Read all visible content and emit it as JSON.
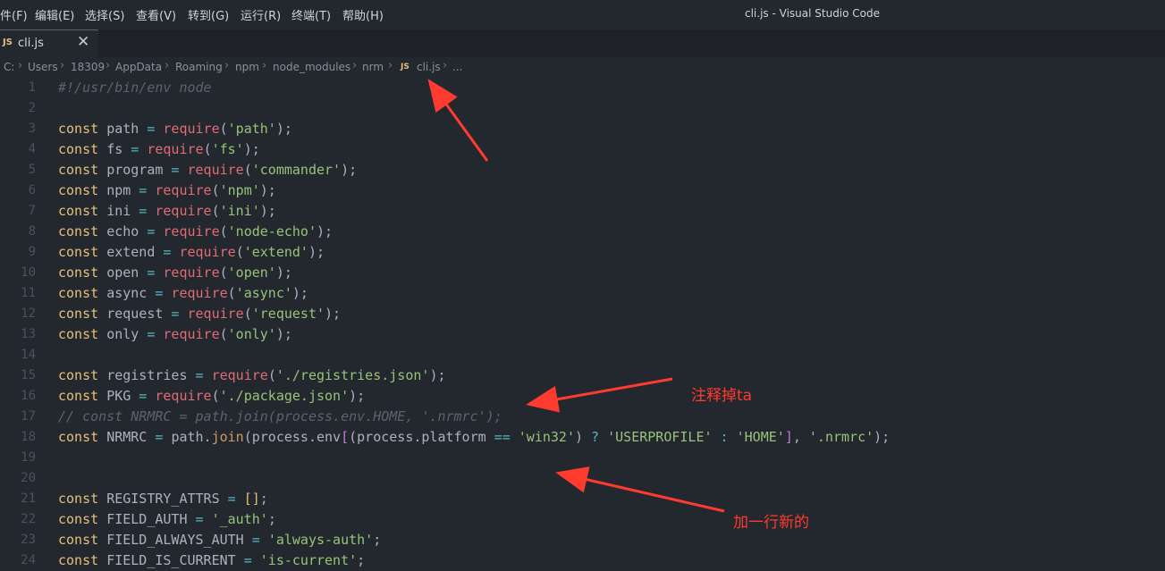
{
  "menu": {
    "items": [
      "件(F)",
      "编辑(E)",
      "选择(S)",
      "查看(V)",
      "转到(G)",
      "运行(R)",
      "终端(T)",
      "帮助(H)"
    ]
  },
  "window_title": "cli.js - Visual Studio Code",
  "tab": {
    "label": "cli.js",
    "badge": "JS",
    "close": "✕"
  },
  "breadcrumb": {
    "items": [
      "C:",
      "Users",
      "18309",
      "AppData",
      "Roaming",
      "npm",
      "node_modules",
      "nrm",
      "cli.js",
      "..."
    ],
    "separator": "›"
  },
  "editor": {
    "lines": [
      {
        "n": "1",
        "tokens": [
          [
            "com",
            "#!/usr/bin/env node"
          ]
        ]
      },
      {
        "n": "2",
        "tokens": []
      },
      {
        "n": "3",
        "tokens": [
          [
            "kw",
            "const"
          ],
          [
            "",
            "path"
          ],
          [
            "op",
            "="
          ],
          [
            "fn",
            "require"
          ],
          [
            "",
            "("
          ],
          [
            "str",
            "'path'"
          ],
          [
            "",
            ");"
          ]
        ]
      },
      {
        "n": "4",
        "tokens": [
          [
            "kw",
            "const"
          ],
          [
            "",
            "fs"
          ],
          [
            "op",
            "="
          ],
          [
            "fn",
            "require"
          ],
          [
            "",
            "("
          ],
          [
            "str",
            "'fs'"
          ],
          [
            "",
            ");"
          ]
        ]
      },
      {
        "n": "5",
        "tokens": [
          [
            "kw",
            "const"
          ],
          [
            "",
            "program"
          ],
          [
            "op",
            "="
          ],
          [
            "fn",
            "require"
          ],
          [
            "",
            "("
          ],
          [
            "str",
            "'commander'"
          ],
          [
            "",
            ");"
          ]
        ]
      },
      {
        "n": "6",
        "tokens": [
          [
            "kw",
            "const"
          ],
          [
            "",
            "npm"
          ],
          [
            "op",
            "="
          ],
          [
            "fn",
            "require"
          ],
          [
            "",
            "("
          ],
          [
            "str",
            "'npm'"
          ],
          [
            "",
            ");"
          ]
        ]
      },
      {
        "n": "7",
        "tokens": [
          [
            "kw",
            "const"
          ],
          [
            "",
            "ini"
          ],
          [
            "op",
            "="
          ],
          [
            "fn",
            "require"
          ],
          [
            "",
            "("
          ],
          [
            "str",
            "'ini'"
          ],
          [
            "",
            ");"
          ]
        ]
      },
      {
        "n": "8",
        "tokens": [
          [
            "kw",
            "const"
          ],
          [
            "",
            "echo"
          ],
          [
            "op",
            "="
          ],
          [
            "fn",
            "require"
          ],
          [
            "",
            "("
          ],
          [
            "str",
            "'node-echo'"
          ],
          [
            "",
            ");"
          ]
        ]
      },
      {
        "n": "9",
        "tokens": [
          [
            "kw",
            "const"
          ],
          [
            "",
            "extend"
          ],
          [
            "op",
            "="
          ],
          [
            "fn",
            "require"
          ],
          [
            "",
            "("
          ],
          [
            "str",
            "'extend'"
          ],
          [
            "",
            ");"
          ]
        ]
      },
      {
        "n": "10",
        "tokens": [
          [
            "kw",
            "const"
          ],
          [
            "",
            "open"
          ],
          [
            "op",
            "="
          ],
          [
            "fn",
            "require"
          ],
          [
            "",
            "("
          ],
          [
            "str",
            "'open'"
          ],
          [
            "",
            ");"
          ]
        ]
      },
      {
        "n": "11",
        "tokens": [
          [
            "kw",
            "const"
          ],
          [
            "",
            "async"
          ],
          [
            "op",
            "="
          ],
          [
            "fn",
            "require"
          ],
          [
            "",
            "("
          ],
          [
            "str",
            "'async'"
          ],
          [
            "",
            ");"
          ]
        ]
      },
      {
        "n": "12",
        "tokens": [
          [
            "kw",
            "const"
          ],
          [
            "",
            "request"
          ],
          [
            "op",
            "="
          ],
          [
            "fn",
            "require"
          ],
          [
            "",
            "("
          ],
          [
            "str",
            "'request'"
          ],
          [
            "",
            ");"
          ]
        ]
      },
      {
        "n": "13",
        "tokens": [
          [
            "kw",
            "const"
          ],
          [
            "",
            "only"
          ],
          [
            "op",
            "="
          ],
          [
            "fn",
            "require"
          ],
          [
            "",
            "("
          ],
          [
            "str",
            "'only'"
          ],
          [
            "",
            ");"
          ]
        ]
      },
      {
        "n": "14",
        "tokens": []
      },
      {
        "n": "15",
        "tokens": [
          [
            "kw",
            "const"
          ],
          [
            "",
            "registries"
          ],
          [
            "op",
            "="
          ],
          [
            "fn",
            "require"
          ],
          [
            "",
            "("
          ],
          [
            "str",
            "'./registries.json'"
          ],
          [
            "",
            ");"
          ]
        ]
      },
      {
        "n": "16",
        "tokens": [
          [
            "kw",
            "const"
          ],
          [
            "",
            "PKG"
          ],
          [
            "op",
            "="
          ],
          [
            "fn",
            "require"
          ],
          [
            "",
            "("
          ],
          [
            "str",
            "'./package.json'"
          ],
          [
            "",
            ");"
          ]
        ]
      },
      {
        "n": "17",
        "tokens": [
          [
            "com",
            "// const NRMRC = path.join(process.env.HOME, '.nrmrc');"
          ]
        ]
      },
      {
        "n": "18",
        "tokens": [
          [
            "kw",
            "const"
          ],
          [
            "",
            "NRMRC"
          ],
          [
            "op",
            "="
          ],
          [
            "",
            "path."
          ],
          [
            "mth",
            "join"
          ],
          [
            "",
            "(process.env"
          ],
          [
            "br2",
            "["
          ],
          [
            "",
            "(process.platform"
          ],
          [
            "op",
            "=="
          ],
          [
            "str",
            "'win32'"
          ],
          [
            "",
            ")"
          ],
          [
            "op",
            "?"
          ],
          [
            "str",
            "'USERPROFILE'"
          ],
          [
            "op",
            ":"
          ],
          [
            "str",
            "'HOME'"
          ],
          [
            "br2",
            "]"
          ],
          [
            "",
            ", "
          ],
          [
            "str",
            "'.nrmrc'"
          ],
          [
            "",
            ");"
          ]
        ]
      },
      {
        "n": "19",
        "tokens": []
      },
      {
        "n": "20",
        "tokens": []
      },
      {
        "n": "21",
        "tokens": [
          [
            "kw",
            "const"
          ],
          [
            "",
            "REGISTRY_ATTRS"
          ],
          [
            "op",
            "="
          ],
          [
            "br1",
            "[]"
          ],
          [
            "",
            ";"
          ]
        ]
      },
      {
        "n": "22",
        "tokens": [
          [
            "kw",
            "const"
          ],
          [
            "",
            "FIELD_AUTH"
          ],
          [
            "op",
            "="
          ],
          [
            "str",
            "'_auth'"
          ],
          [
            "",
            ";"
          ]
        ]
      },
      {
        "n": "23",
        "tokens": [
          [
            "kw",
            "const"
          ],
          [
            "",
            "FIELD_ALWAYS_AUTH"
          ],
          [
            "op",
            "="
          ],
          [
            "str",
            "'always-auth'"
          ],
          [
            "",
            ";"
          ]
        ]
      },
      {
        "n": "24",
        "tokens": [
          [
            "kw",
            "const"
          ],
          [
            "",
            "FIELD_IS_CURRENT"
          ],
          [
            "op",
            "="
          ],
          [
            "str",
            "'is-current'"
          ],
          [
            "",
            ";"
          ]
        ]
      }
    ]
  },
  "annotations": {
    "comment_out_note": "注释掉ta",
    "add_line_note": "加一行新的"
  },
  "colors": {
    "background": "#23272e",
    "keyword": "#e5c07b",
    "function": "#e06c75",
    "string": "#98c379",
    "comment": "#5c6370",
    "operator": "#56b6c2",
    "annotation": "#ff3b30"
  }
}
